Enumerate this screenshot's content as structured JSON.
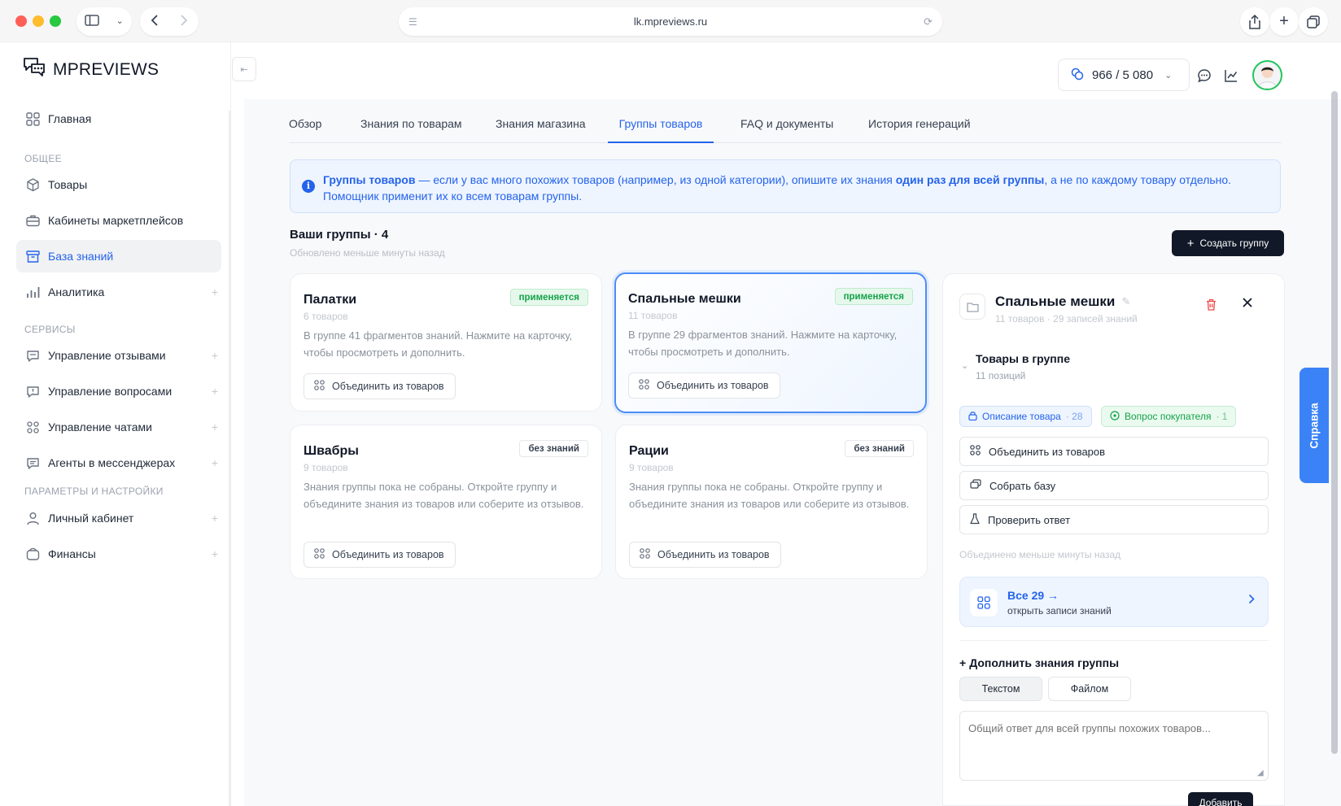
{
  "browser": {
    "url": "lk.mpreviews.ru"
  },
  "app": {
    "logo_text": "MPREVIEWS"
  },
  "sidebar": {
    "items": [
      {
        "label": "Главная",
        "icon": "grid-icon"
      },
      {
        "label": "Товары",
        "icon": "cubes-icon"
      },
      {
        "label": "Кабинеты маркетплейсов",
        "icon": "briefcase-icon"
      },
      {
        "label": "База знаний",
        "icon": "archive-icon",
        "active": true
      },
      {
        "label": "Аналитика",
        "icon": "bar-chart-icon"
      },
      {
        "label": "Управление отзывами",
        "icon": "reviews-icon"
      },
      {
        "label": "Управление вопросами",
        "icon": "question-bubble-icon"
      },
      {
        "label": "Управление чатами",
        "icon": "chats-icon"
      },
      {
        "label": "Агенты в мессенджерах",
        "icon": "messenger-icon"
      },
      {
        "label": "Личный кабинет",
        "icon": "user-icon"
      },
      {
        "label": "Финансы",
        "icon": "wallet-icon"
      }
    ],
    "sections": [
      "ОБЩЕЕ",
      "СЕРВИСЫ",
      "ПАРАМЕТРЫ И НАСТРОЙКИ"
    ]
  },
  "header": {
    "balance": "966 / 5 080"
  },
  "tabs": [
    "Обзор",
    "Знания по товарам",
    "Знания магазина",
    "Группы товаров",
    "FAQ и документы",
    "История генераций"
  ],
  "info": {
    "p1": "Группы товаров",
    "p2": " — если у вас много похожих товаров (например, из одной категории), опишите их знания ",
    "p3": "один раз для всей группы",
    "p4": ", а не по каждому товару отдельно. Помощник применит их ко всем товарам группы."
  },
  "groups": {
    "title": "Ваши группы · 4",
    "updated": "Обновлено меньше минуты назад",
    "create_label": "Создать группу",
    "merge_label": "Объединить из товаров",
    "cards": [
      {
        "title": "Палатки",
        "count": "6 товаров",
        "status": "применяется",
        "desc": "В группе 41 фрагментов знаний. Нажмите на карточку, чтобы просмотреть и дополнить."
      },
      {
        "title": "Спальные мешки",
        "count": "11 товаров",
        "status": "применяется",
        "desc": "В группе 29 фрагментов знаний. Нажмите на карточку, чтобы просмотреть и дополнить."
      },
      {
        "title": "Швабры",
        "count": "9 товаров",
        "status": "без знаний",
        "desc": "Знания группы пока не собраны. Откройте группу и объедините знания из товаров или соберите из отзывов."
      },
      {
        "title": "Рации",
        "count": "9 товаров",
        "status": "без знаний",
        "desc": "Знания группы пока не собраны. Откройте группу и объедините знания из товаров или соберите из отзывов."
      }
    ]
  },
  "panel": {
    "title": "Спальные мешки",
    "subtitle": "11 товаров · 29 записей знаний",
    "section_title": "Товары в группе",
    "section_sub": "11 позиций",
    "chip1_label": "Описание товара",
    "chip1_count": "· 28",
    "chip2_label": "Вопрос покупателя",
    "chip2_count": "· 1",
    "btn_merge": "Объединить из товаров",
    "btn_collect": "Собрать базу",
    "btn_check": "Проверить ответ",
    "merged_note": "Объединено меньше минуты назад",
    "all_title": "Все 29 →",
    "all_sub": "открыть записи знаний",
    "add_title": "Дополнить знания группы",
    "seg_text": "Текстом",
    "seg_file": "Файлом",
    "textarea_placeholder": "Общий ответ для всей группы похожих товаров...",
    "add_btn": "Добавить"
  },
  "help": "Справка",
  "colors": {
    "accent": "#2563eb",
    "success": "#16a34a",
    "danger": "#ef4444",
    "dark": "#111827"
  }
}
